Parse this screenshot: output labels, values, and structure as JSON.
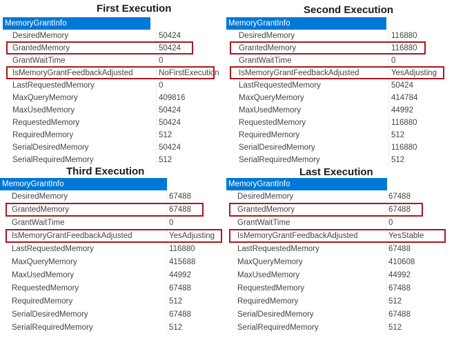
{
  "header_label": "MemoryGrantInfo",
  "panels": [
    {
      "title": "First Execution",
      "rows": [
        {
          "name": "DesiredMemory",
          "value": "50424"
        },
        {
          "name": "GrantedMemory",
          "value": "50424"
        },
        {
          "name": "GrantWaitTime",
          "value": "0"
        },
        {
          "name": "IsMemoryGrantFeedbackAdjusted",
          "value": "NoFirstExecution"
        },
        {
          "name": "LastRequestedMemory",
          "value": "0"
        },
        {
          "name": "MaxQueryMemory",
          "value": "409816"
        },
        {
          "name": "MaxUsedMemory",
          "value": "50424"
        },
        {
          "name": "RequestedMemory",
          "value": "50424"
        },
        {
          "name": "RequiredMemory",
          "value": "512"
        },
        {
          "name": "SerialDesiredMemory",
          "value": "50424"
        },
        {
          "name": "SerialRequiredMemory",
          "value": "512"
        }
      ]
    },
    {
      "title": "Second Execution",
      "rows": [
        {
          "name": "DesiredMemory",
          "value": "116880"
        },
        {
          "name": "GrantedMemory",
          "value": "116880"
        },
        {
          "name": "GrantWaitTime",
          "value": "0"
        },
        {
          "name": "IsMemoryGrantFeedbackAdjusted",
          "value": "YesAdjusting"
        },
        {
          "name": "LastRequestedMemory",
          "value": "50424"
        },
        {
          "name": "MaxQueryMemory",
          "value": "414784"
        },
        {
          "name": "MaxUsedMemory",
          "value": "44992"
        },
        {
          "name": "RequestedMemory",
          "value": "116880"
        },
        {
          "name": "RequiredMemory",
          "value": "512"
        },
        {
          "name": "SerialDesiredMemory",
          "value": "116880"
        },
        {
          "name": "SerialRequiredMemory",
          "value": "512"
        }
      ]
    },
    {
      "title": "Third Execution",
      "rows": [
        {
          "name": "DesiredMemory",
          "value": "67488"
        },
        {
          "name": "GrantedMemory",
          "value": "67488"
        },
        {
          "name": "GrantWaitTime",
          "value": "0"
        },
        {
          "name": "IsMemoryGrantFeedbackAdjusted",
          "value": "YesAdjusting"
        },
        {
          "name": "LastRequestedMemory",
          "value": "116880"
        },
        {
          "name": "MaxQueryMemory",
          "value": "415688"
        },
        {
          "name": "MaxUsedMemory",
          "value": "44992"
        },
        {
          "name": "RequestedMemory",
          "value": "67488"
        },
        {
          "name": "RequiredMemory",
          "value": "512"
        },
        {
          "name": "SerialDesiredMemory",
          "value": "67488"
        },
        {
          "name": "SerialRequiredMemory",
          "value": "512"
        }
      ]
    },
    {
      "title": "Last Execution",
      "rows": [
        {
          "name": "DesiredMemory",
          "value": "67488"
        },
        {
          "name": "GrantedMemory",
          "value": "67488"
        },
        {
          "name": "GrantWaitTime",
          "value": "0"
        },
        {
          "name": "IsMemoryGrantFeedbackAdjusted",
          "value": "YesStable"
        },
        {
          "name": "LastRequestedMemory",
          "value": "67488"
        },
        {
          "name": "MaxQueryMemory",
          "value": "410608"
        },
        {
          "name": "MaxUsedMemory",
          "value": "44992"
        },
        {
          "name": "RequestedMemory",
          "value": "67488"
        },
        {
          "name": "RequiredMemory",
          "value": "512"
        },
        {
          "name": "SerialDesiredMemory",
          "value": "67488"
        },
        {
          "name": "SerialRequiredMemory",
          "value": "512"
        }
      ]
    }
  ],
  "colors": {
    "header_bg": "#0078d7",
    "highlight_border": "#a8161c",
    "text": "#444444"
  }
}
